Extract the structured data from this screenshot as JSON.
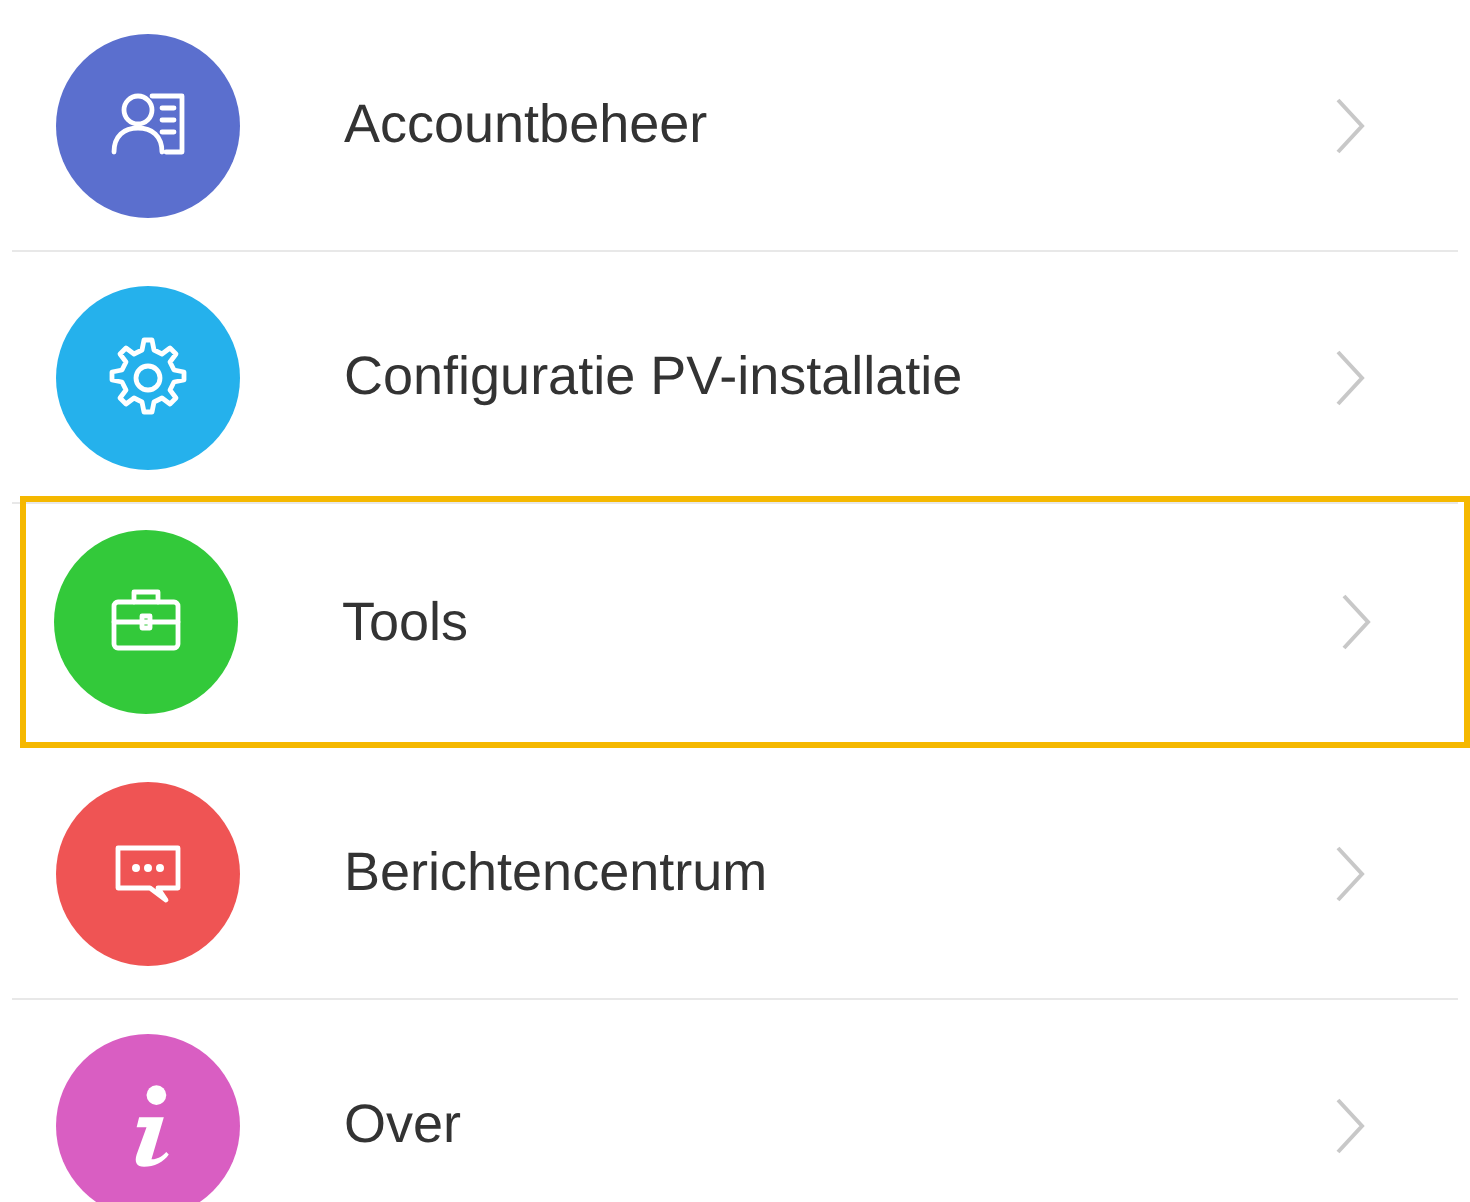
{
  "menu": {
    "items": [
      {
        "label": "Accountbeheer",
        "color": "#5b6fce",
        "selected": false
      },
      {
        "label": "Configuratie PV-installatie",
        "color": "#25b1ec",
        "selected": false
      },
      {
        "label": "Tools",
        "color": "#33c93a",
        "selected": true
      },
      {
        "label": "Berichtencentrum",
        "color": "#ef5454",
        "selected": false
      },
      {
        "label": "Over",
        "color": "#d95ec2",
        "selected": false
      }
    ]
  }
}
